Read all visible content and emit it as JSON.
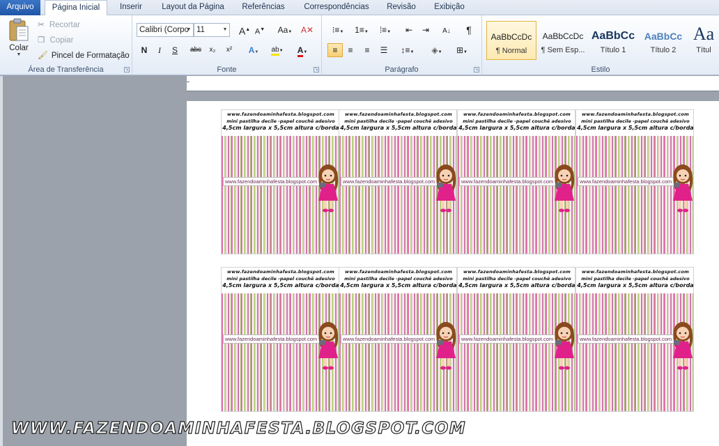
{
  "tabs": {
    "file": "Arquivo",
    "home": "Página Inicial",
    "insert": "Inserir",
    "layout": "Layout da Página",
    "references": "Referências",
    "mailings": "Correspondências",
    "review": "Revisão",
    "view": "Exibição"
  },
  "clipboard": {
    "paste": "Colar",
    "cut": "Recortar",
    "copy": "Copiar",
    "format_painter": "Pincel de Formatação",
    "label": "Área de Transferência"
  },
  "font": {
    "family": "Calibri (Corpo",
    "size": "11",
    "label": "Fonte",
    "bold": "N",
    "italic": "I",
    "underline": "S",
    "strike": "abc",
    "sub": "x₂",
    "sup": "x²",
    "grow": "A",
    "shrink": "A",
    "case": "Aa",
    "text_effects": "A",
    "highlight": "ab",
    "color": "A"
  },
  "paragraph": {
    "label": "Parágrafo",
    "pilcrow": "¶"
  },
  "styles": {
    "label": "Estilo",
    "items": [
      {
        "sample": "AaBbCcDc",
        "name": "¶ Normal"
      },
      {
        "sample": "AaBbCcDc",
        "name": "¶ Sem Esp..."
      },
      {
        "sample": "AaBbCc",
        "name": "Título 1"
      },
      {
        "sample": "AaBbCc",
        "name": "Título 2"
      },
      {
        "sample": "Aa",
        "name": "Títul"
      }
    ]
  },
  "card": {
    "line1": "www.fazendoaminhafesta.blogspot.com",
    "line2": "mini pastilha decile -papel couchê adesivo",
    "line3": "4,5cm largura x 5,5cm altura c/borda",
    "url": "www.fazendoaminhafesta.blogspot.com"
  },
  "watermark": "WWW.FAZENDOAMINHAFESTA.BLOGSPOT.COM",
  "colors": {
    "stripe_pink": "#d8408f",
    "stripe_green": "#9ec24f",
    "ribbon_accent": "#1f56a8"
  }
}
